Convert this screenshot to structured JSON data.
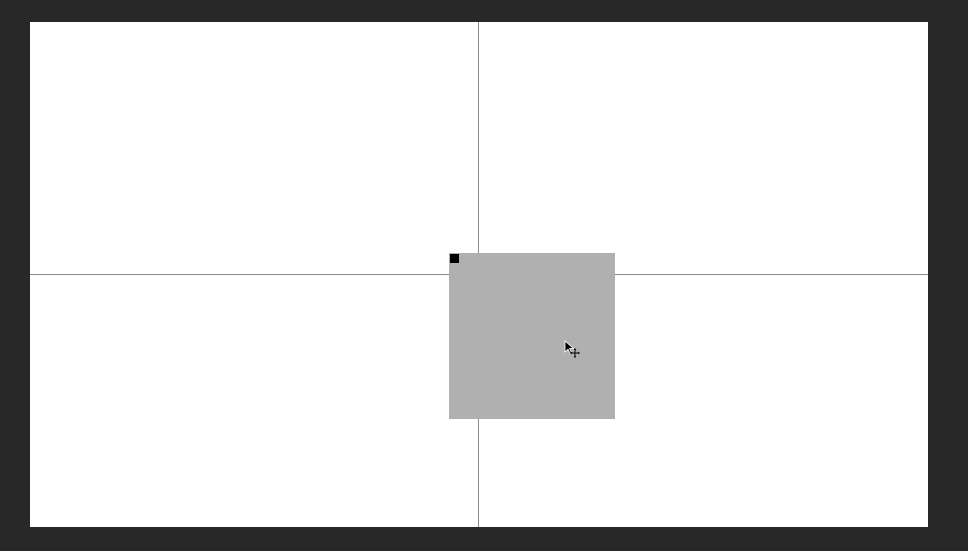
{
  "colors": {
    "workspace": "#282828",
    "canvas": "#ffffff",
    "guide": "#8a8a8a",
    "layer_fill": "#b0b0b0",
    "anchor": "#000000"
  },
  "icons": {
    "cursor": "move-tool-cursor-icon",
    "anchor": "selection-anchor-handle"
  }
}
